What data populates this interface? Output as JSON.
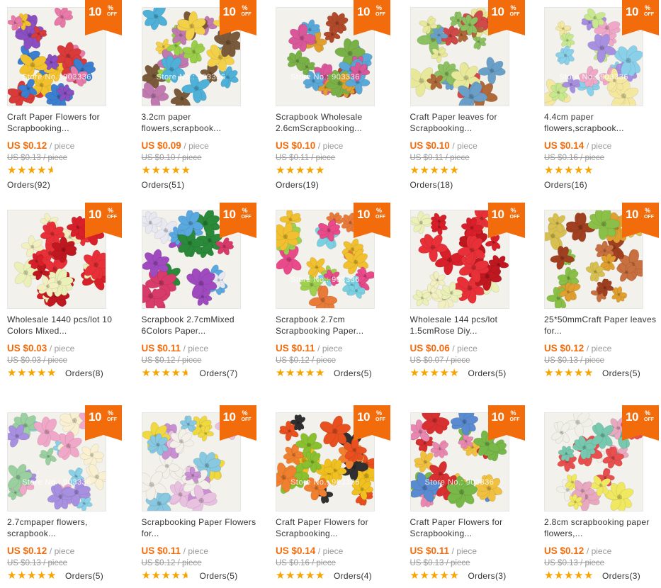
{
  "badge": {
    "num": "10",
    "pct": "%",
    "off": "OFF"
  },
  "star_char": "★",
  "products": [
    {
      "title": "Craft Paper Flowers for Scrapbooking...",
      "price": "US $0.12",
      "unit": "/ piece",
      "orig": "US $0.13 / piece",
      "orders": "Orders(92)",
      "rating": 4.5,
      "watermark": "Store No.: 903336",
      "colors": [
        "#d93a3a",
        "#3c7fd0",
        "#f2c12e",
        "#e87aa8",
        "#8a4fc0"
      ]
    },
    {
      "title": "3.2cm paper flowers,scrapbook...",
      "price": "US $0.09",
      "unit": "/ piece",
      "orig": "US $0.10 / piece",
      "orders": "Orders(51)",
      "rating": 5,
      "watermark": "Store No.: 903336",
      "colors": [
        "#7a5a3a",
        "#4fb0d8",
        "#9bcf4a",
        "#f2d04a",
        "#c07ab0"
      ]
    },
    {
      "title": "Scrapbook Wholesale 2.6cmScrapbooking...",
      "price": "US $0.10",
      "unit": "/ piece",
      "orig": "US $0.11 / piece",
      "orders": "Orders(19)",
      "rating": 5,
      "watermark": "Store No.: 903336",
      "colors": [
        "#5aa8d8",
        "#d8589a",
        "#7ab048",
        "#b04a2a",
        "#e0a030"
      ]
    },
    {
      "title": "Craft Paper leaves for Scrapbooking...",
      "price": "US $0.10",
      "unit": "/ piece",
      "orig": "US $0.11 / piece",
      "orders": "Orders(18)",
      "rating": 5,
      "watermark": "",
      "colors": [
        "#8cc060",
        "#e8e89a",
        "#6aa0c8",
        "#b06a3a",
        "#d04a4a"
      ]
    },
    {
      "title": "4.4cm paper flowers,scrapbook...",
      "price": "US $0.14",
      "unit": "/ piece",
      "orig": "US $0.16 / piece",
      "orders": "Orders(16)",
      "rating": 5,
      "watermark": "Store No.: 903336",
      "colors": [
        "#a890e0",
        "#8ad0e8",
        "#f4e8a0",
        "#f0a8c8",
        "#c8e890"
      ]
    },
    {
      "title": "Wholesale 1440 pcs/lot 10 Colors Mixed...",
      "price": "US $0.03",
      "unit": "/ piece",
      "orig": "US $0.03 / piece",
      "orders": "Orders(8)",
      "rating": 5,
      "watermark": "",
      "colors": [
        "#d8202a",
        "#e83038",
        "#f2f0c0",
        "#eaf0b8",
        "#c01820"
      ]
    },
    {
      "title": "Scrapbook 2.7cmMixed 6Colors Paper...",
      "price": "US $0.11",
      "unit": "/ piece",
      "orig": "US $0.12 / piece",
      "orders": "Orders(7)",
      "rating": 4.5,
      "watermark": "",
      "colors": [
        "#2a8a3a",
        "#5aa8e0",
        "#d83a6a",
        "#e8e8f0",
        "#a04ac0"
      ]
    },
    {
      "title": "Scrapbook 2.7cm Scrapbooking Paper...",
      "price": "US $0.11",
      "unit": "/ piece",
      "orig": "US $0.12 / piece",
      "orders": "Orders(5)",
      "rating": 5,
      "watermark": "Store No.: 903336",
      "colors": [
        "#e84a8a",
        "#f0c030",
        "#7ad0e0",
        "#a0d050",
        "#e87a3a"
      ]
    },
    {
      "title": "Wholesale 144 pcs/lot 1.5cmRose Diy...",
      "price": "US $0.06",
      "unit": "/ piece",
      "orig": "US $0.07 / piece",
      "orders": "Orders(5)",
      "rating": 5,
      "watermark": "",
      "colors": [
        "#d8202a",
        "#e83038",
        "#f2f0c0",
        "#eaf0b8",
        "#c01820"
      ]
    },
    {
      "title": "25*50mmCraft Paper leaves for...",
      "price": "US $0.12",
      "unit": "/ piece",
      "orig": "US $0.13 / piece",
      "orders": "Orders(5)",
      "rating": 5,
      "watermark": "",
      "colors": [
        "#8ac048",
        "#e0a030",
        "#c87040",
        "#d8c050",
        "#a04020"
      ]
    },
    {
      "title": "2.7cmpaper flowers, scrapbook...",
      "price": "US $0.12",
      "unit": "/ piece",
      "orig": "US $0.13 / piece",
      "orders": "Orders(5)",
      "rating": 5,
      "watermark": "Store No.: 903336",
      "colors": [
        "#f0a8c8",
        "#a890e0",
        "#8ad0e8",
        "#f8f0d0",
        "#9ad0a0"
      ]
    },
    {
      "title": "Scrapbooking Paper Flowers for...",
      "price": "US $0.11",
      "unit": "/ piece",
      "orig": "US $0.12 / piece",
      "orders": "Orders(5)",
      "rating": 4.5,
      "watermark": "",
      "colors": [
        "#f2f0e8",
        "#e8c0e0",
        "#f0d840",
        "#c890d0",
        "#88c8e0"
      ]
    },
    {
      "title": "Craft Paper Flowers for Scrapbooking...",
      "price": "US $0.14",
      "unit": "/ piece",
      "orig": "US $0.16 / piece",
      "orders": "Orders(4)",
      "rating": 5,
      "watermark": "Store No.: 903336",
      "colors": [
        "#f0c020",
        "#e85020",
        "#8ac030",
        "#303030",
        "#f08030"
      ]
    },
    {
      "title": "Craft Paper Flowers for Scrapbooking...",
      "price": "US $0.11",
      "unit": "/ piece",
      "orig": "US $0.13 / piece",
      "orders": "Orders(3)",
      "rating": 5,
      "watermark": "Store No.: 903336",
      "colors": [
        "#d83030",
        "#78b848",
        "#e888b0",
        "#f0c040",
        "#5a8ad0"
      ]
    },
    {
      "title": "2.8cm scrapbooking paper flowers,...",
      "price": "US $0.12",
      "unit": "/ piece",
      "orig": "US $0.13 / piece",
      "orders": "Orders(3)",
      "rating": 5,
      "watermark": "",
      "colors": [
        "#f0e860",
        "#e85050",
        "#f0f0e8",
        "#78c8b0",
        "#e8a8c0"
      ]
    }
  ]
}
